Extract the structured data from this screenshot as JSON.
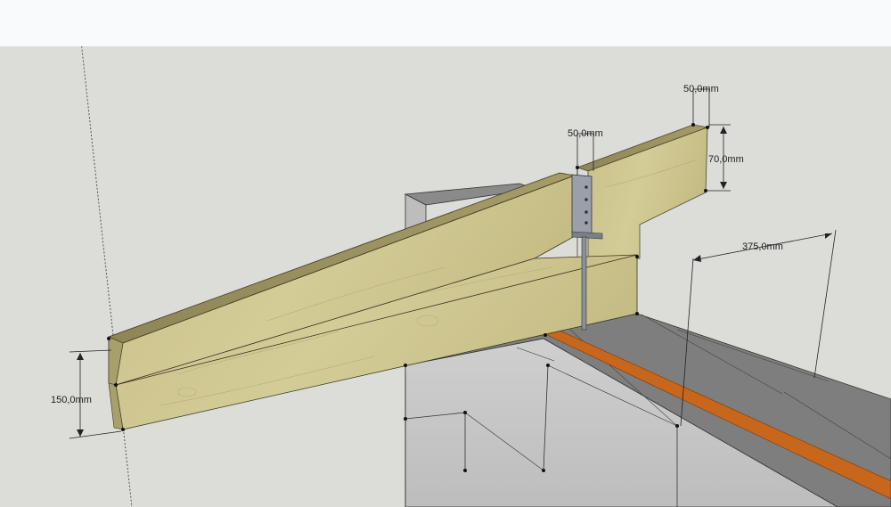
{
  "dimensions": {
    "height": "150,0mm",
    "width_front": "50,0mm",
    "width_back": "50,0mm",
    "depth": "70,0mm",
    "spacing": "375,0mm"
  },
  "colors": {
    "background": "#dcdcd8",
    "top_bar": "#f9fafb",
    "wood": "#cdc58e",
    "wood_edge": "#6b6540",
    "concrete": "#c8c8c8",
    "concrete_top": "#7d7d7d",
    "membrane": "#c8661c",
    "metal": "#8a9098"
  }
}
